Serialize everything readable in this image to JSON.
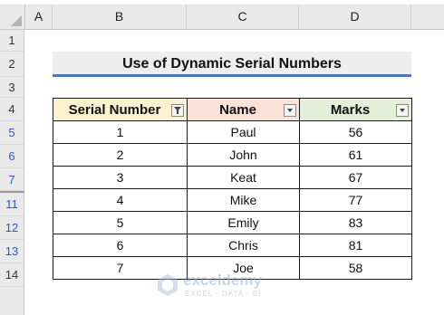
{
  "columns": [
    "A",
    "B",
    "C",
    "D"
  ],
  "rows": [
    "1",
    "2",
    "3",
    "4",
    "5",
    "6",
    "7",
    "11",
    "12",
    "13",
    "14"
  ],
  "title": "Use of Dynamic Serial Numbers",
  "headers": {
    "serial": "Serial Number",
    "name": "Name",
    "marks": "Marks"
  },
  "filter": {
    "serial_state": "filtered",
    "name_state": "dropdown",
    "marks_state": "dropdown"
  },
  "table_rows": [
    {
      "serial": "1",
      "name": "Paul",
      "marks": "56"
    },
    {
      "serial": "2",
      "name": "John",
      "marks": "61"
    },
    {
      "serial": "3",
      "name": "Keat",
      "marks": "67"
    },
    {
      "serial": "4",
      "name": "Mike",
      "marks": "77"
    },
    {
      "serial": "5",
      "name": "Emily",
      "marks": "83"
    },
    {
      "serial": "6",
      "name": "Chris",
      "marks": "81"
    },
    {
      "serial": "7",
      "name": "Joe",
      "marks": "58"
    }
  ],
  "watermark": {
    "name": "exceldemy",
    "tagline": "EXCEL · DATA · BI"
  },
  "colors": {
    "header_serial": "#fdf2d0",
    "header_name": "#fce3d8",
    "header_marks": "#e4efd9",
    "title_underline": "#4a78b8",
    "row_number_blue": "#2a58c6"
  }
}
